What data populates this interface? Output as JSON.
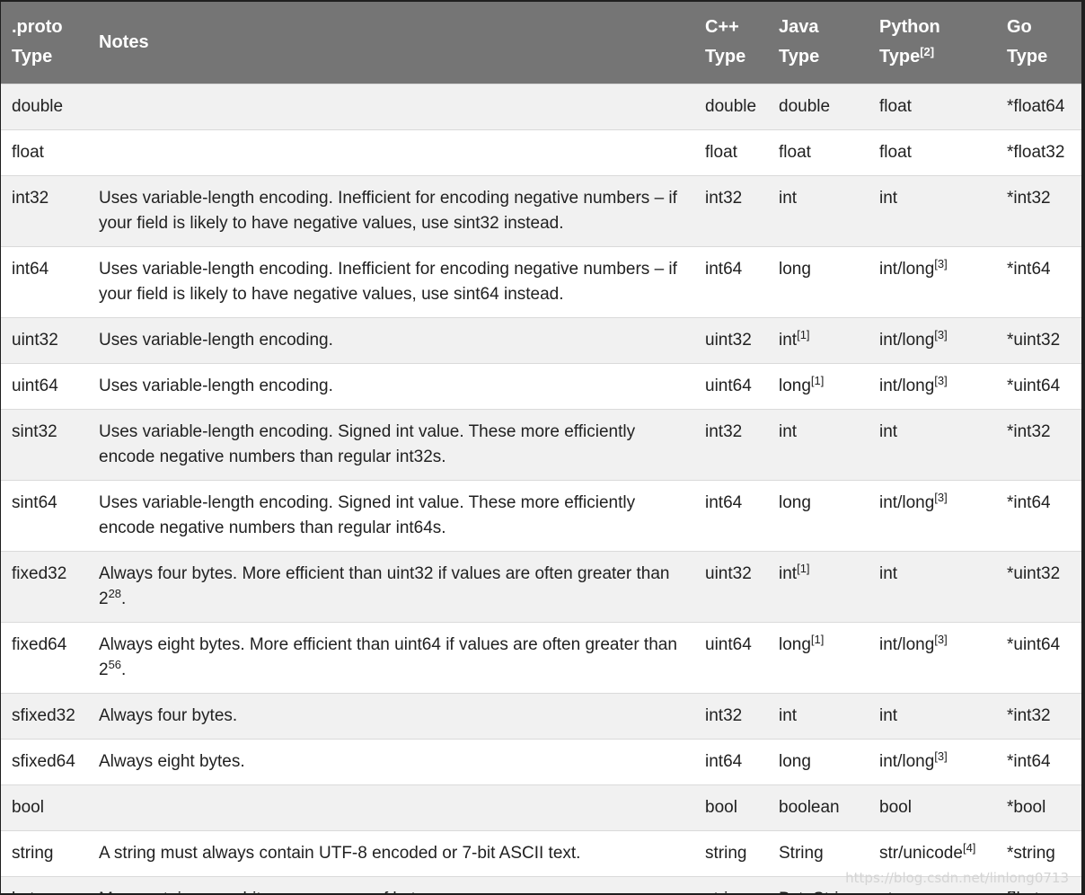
{
  "headers": [
    {
      "line1": ".proto",
      "line2": "Type",
      "sup": ""
    },
    {
      "line1": "Notes",
      "line2": "",
      "sup": ""
    },
    {
      "line1": "C++",
      "line2": "Type",
      "sup": ""
    },
    {
      "line1": "Java",
      "line2": "Type",
      "sup": ""
    },
    {
      "line1": "Python",
      "line2": "Type",
      "sup": "[2]"
    },
    {
      "line1": "Go",
      "line2": "Type",
      "sup": ""
    }
  ],
  "rows": [
    {
      "proto": "double",
      "notes": "",
      "notes_sup": "",
      "notes_after": "",
      "cpp": "double",
      "java": "double",
      "java_sup": "",
      "python": "float",
      "python_sup": "",
      "go": "*float64"
    },
    {
      "proto": "float",
      "notes": "",
      "notes_sup": "",
      "notes_after": "",
      "cpp": "float",
      "java": "float",
      "java_sup": "",
      "python": "float",
      "python_sup": "",
      "go": "*float32"
    },
    {
      "proto": "int32",
      "notes": "Uses variable-length encoding. Inefficient for encoding negative numbers – if your field is likely to have negative values, use sint32 instead.",
      "notes_sup": "",
      "notes_after": "",
      "cpp": "int32",
      "java": "int",
      "java_sup": "",
      "python": "int",
      "python_sup": "",
      "go": "*int32"
    },
    {
      "proto": "int64",
      "notes": "Uses variable-length encoding. Inefficient for encoding negative numbers – if your field is likely to have negative values, use sint64 instead.",
      "notes_sup": "",
      "notes_after": "",
      "cpp": "int64",
      "java": "long",
      "java_sup": "",
      "python": "int/long",
      "python_sup": "[3]",
      "go": "*int64"
    },
    {
      "proto": "uint32",
      "notes": "Uses variable-length encoding.",
      "notes_sup": "",
      "notes_after": "",
      "cpp": "uint32",
      "java": "int",
      "java_sup": "[1]",
      "python": "int/long",
      "python_sup": "[3]",
      "go": "*uint32"
    },
    {
      "proto": "uint64",
      "notes": "Uses variable-length encoding.",
      "notes_sup": "",
      "notes_after": "",
      "cpp": "uint64",
      "java": "long",
      "java_sup": "[1]",
      "python": "int/long",
      "python_sup": "[3]",
      "go": "*uint64"
    },
    {
      "proto": "sint32",
      "notes": "Uses variable-length encoding. Signed int value. These more efficiently encode negative numbers than regular int32s.",
      "notes_sup": "",
      "notes_after": "",
      "cpp": "int32",
      "java": "int",
      "java_sup": "",
      "python": "int",
      "python_sup": "",
      "go": "*int32"
    },
    {
      "proto": "sint64",
      "notes": "Uses variable-length encoding. Signed int value. These more efficiently encode negative numbers than regular int64s.",
      "notes_sup": "",
      "notes_after": "",
      "cpp": "int64",
      "java": "long",
      "java_sup": "",
      "python": "int/long",
      "python_sup": "[3]",
      "go": "*int64"
    },
    {
      "proto": "fixed32",
      "notes": "Always four bytes. More efficient than uint32 if values are often greater than 2",
      "notes_sup": "28",
      "notes_after": ".",
      "cpp": "uint32",
      "java": "int",
      "java_sup": "[1]",
      "python": "int",
      "python_sup": "",
      "go": "*uint32"
    },
    {
      "proto": "fixed64",
      "notes": "Always eight bytes. More efficient than uint64 if values are often greater than 2",
      "notes_sup": "56",
      "notes_after": ".",
      "cpp": "uint64",
      "java": "long",
      "java_sup": "[1]",
      "python": "int/long",
      "python_sup": "[3]",
      "go": "*uint64"
    },
    {
      "proto": "sfixed32",
      "notes": "Always four bytes.",
      "notes_sup": "",
      "notes_after": "",
      "cpp": "int32",
      "java": "int",
      "java_sup": "",
      "python": "int",
      "python_sup": "",
      "go": "*int32"
    },
    {
      "proto": "sfixed64",
      "notes": "Always eight bytes.",
      "notes_sup": "",
      "notes_after": "",
      "cpp": "int64",
      "java": "long",
      "java_sup": "",
      "python": "int/long",
      "python_sup": "[3]",
      "go": "*int64"
    },
    {
      "proto": "bool",
      "notes": "",
      "notes_sup": "",
      "notes_after": "",
      "cpp": "bool",
      "java": "boolean",
      "java_sup": "",
      "python": "bool",
      "python_sup": "",
      "go": "*bool"
    },
    {
      "proto": "string",
      "notes": "A string must always contain UTF-8 encoded or 7-bit ASCII text.",
      "notes_sup": "",
      "notes_after": "",
      "cpp": "string",
      "java": "String",
      "java_sup": "",
      "python": "str/unicode",
      "python_sup": "[4]",
      "go": "*string"
    },
    {
      "proto": "bytes",
      "notes": "May contain any arbitrary sequence of bytes.",
      "notes_sup": "",
      "notes_after": "",
      "cpp": "string",
      "java": "ByteString",
      "java_sup": "",
      "python": "str",
      "python_sup": "",
      "go": "[]byte"
    }
  ],
  "watermark": "https://blog.csdn.net/linlong0713",
  "colors": {
    "header_bg": "#757575",
    "header_text": "#ffffff",
    "row_odd": "#f1f1f1",
    "row_even": "#ffffff",
    "text": "#212121"
  }
}
